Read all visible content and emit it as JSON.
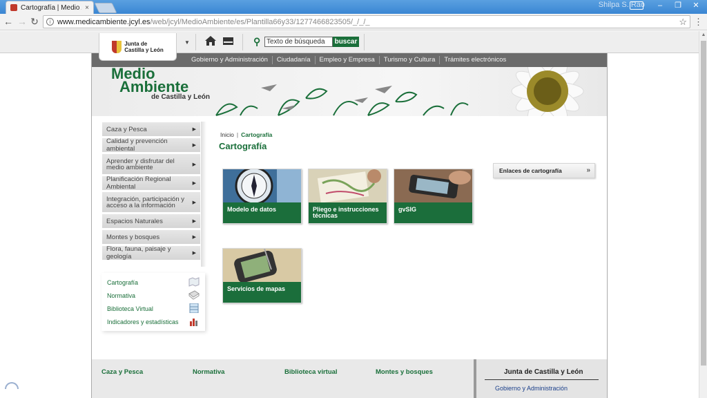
{
  "browser": {
    "tab_title": "Cartografía | Medio Amb",
    "tab_close": "×",
    "user_name": "Shilpa S. Rao",
    "url_host": "www.medicambiente.jcyl.es",
    "url_path": "/web/jcyl/MedioAmbiente/es/Plantilla66y33/1277466823505/_/_/_",
    "minimize": "–",
    "maximize": "❐",
    "close": "✕",
    "back": "←",
    "forward": "→",
    "reload": "↻",
    "star": "☆",
    "menu": "⋮"
  },
  "topbar": {
    "logo_line1": "Junta de",
    "logo_line2": "Castilla y León",
    "search_placeholder": "Texto de búsqueda",
    "search_button": "buscar"
  },
  "navbar": {
    "items": [
      "Gobierno y Administración",
      "Ciudadanía",
      "Empleo y Empresa",
      "Turismo y Cultura",
      "Trámites electrónicos"
    ]
  },
  "banner": {
    "brand_line1": "Medio",
    "brand_line2": "Ambiente",
    "brand_line3": "de Castilla y León"
  },
  "side_menu": {
    "items": [
      {
        "label": "Caza y Pesca"
      },
      {
        "label": "Calidad y prevención ambiental"
      },
      {
        "label": "Aprender y disfrutar del medio ambiente"
      },
      {
        "label": "Planificación Regional Ambiental"
      },
      {
        "label": "Integración, participación y acceso a la información"
      },
      {
        "label": "Espacios Naturales"
      },
      {
        "label": "Montes y bosques"
      },
      {
        "label": "Flora, fauna, paisaje y geología"
      }
    ]
  },
  "quicklinks": {
    "items": [
      {
        "label": "Cartografía",
        "icon": "map-icon"
      },
      {
        "label": "Normativa",
        "icon": "book-icon"
      },
      {
        "label": "Biblioteca Virtual",
        "icon": "archive-icon"
      },
      {
        "label": "Indicadores y estadísticas",
        "icon": "chart-icon"
      }
    ]
  },
  "breadcrumb": {
    "home": "Inicio",
    "sep": "|",
    "current": "Cartografía"
  },
  "page_title": "Cartografía",
  "cards": [
    {
      "label": "Modelo de datos"
    },
    {
      "label": "Pliego e instrucciones técnicas"
    },
    {
      "label": "gvSIG"
    },
    {
      "label": "Servicios de mapas"
    }
  ],
  "side_link": {
    "label": "Enlaces de cartografía",
    "chevron": "»"
  },
  "footer": {
    "columns": [
      "Caza y Pesca",
      "Normativa",
      "Biblioteca virtual",
      "Montes y bosques"
    ],
    "box_title": "Junta de Castilla y León",
    "box_link": "Gobierno y Administración"
  },
  "colors": {
    "brand_green": "#1a6f3a",
    "nav_gray": "#6b6b6b"
  }
}
